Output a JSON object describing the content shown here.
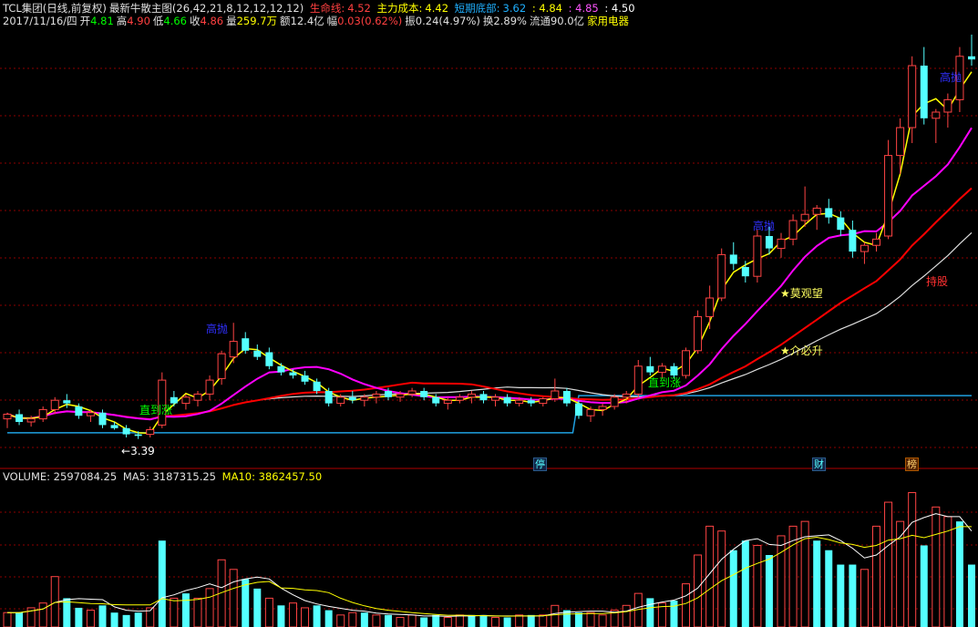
{
  "header": {
    "title": "TCL集团(日线,前复权)",
    "indicator": "最新牛散主图(26,42,21,8,12,12,12,12)",
    "life_label": "生命线:",
    "life_value": "4.52",
    "cost_label": "主力成本:",
    "cost_value": "4.42",
    "bottom_label": "短期底部:",
    "bottom_value": "3.62",
    "v1": ": 4.84",
    "v2": ": 4.85",
    "v3": ": 4.50",
    "date": "2017/11/16/四",
    "open_label": "开",
    "open": "4.81",
    "high_label": "高",
    "high": "4.90",
    "low_label": "低",
    "low": "4.66",
    "close_label": "收",
    "close": "4.86",
    "vol_label": "量",
    "vol": "259.7万",
    "amt_label": "额",
    "amt": "12.4亿",
    "chg_label": "幅",
    "chg": "0.03(0.62%)",
    "amp_label": "振",
    "amp": "0.24(4.97%)",
    "turn_label": "换",
    "turn": "2.89%",
    "float_label": "流通",
    "float": "90.0亿",
    "sector": "家用电器"
  },
  "volume_header": {
    "volume": "VOLUME: 2597084.25",
    "ma5": "MA5: 3187315.25",
    "ma10": "MA10: 3862457.50"
  },
  "annotations": {
    "low_price": "3.39",
    "gaopao1": "高抛",
    "gaopao2": "高抛",
    "gaopao3": "高抛",
    "zhidaozhang1": "直到涨",
    "zhidaozhang2": "直到涨",
    "moguanwang": "★莫观望",
    "jiebisheng": "★介必升",
    "chigu": "持股",
    "tag_ting": "停",
    "tag_cai": "财",
    "tag_bang": "榜"
  },
  "colors": {
    "up": "#ff4444",
    "down": "#54ffff",
    "ma_yellow": "#ffff00",
    "ma_magenta": "#ff00ff",
    "ma_red": "#ff0000",
    "ma_white": "#dddddd",
    "support": "#1fa0e0",
    "grid": "#8b0000"
  },
  "chart_data": {
    "type": "candlestick",
    "y_range_price": [
      3.3,
      6.0
    ],
    "candles": [
      [
        3.52,
        3.56,
        3.46,
        3.55
      ],
      [
        3.55,
        3.58,
        3.48,
        3.5
      ],
      [
        3.5,
        3.54,
        3.47,
        3.52
      ],
      [
        3.52,
        3.6,
        3.5,
        3.58
      ],
      [
        3.58,
        3.66,
        3.55,
        3.64
      ],
      [
        3.64,
        3.68,
        3.59,
        3.62
      ],
      [
        3.6,
        3.62,
        3.52,
        3.54
      ],
      [
        3.54,
        3.58,
        3.5,
        3.56
      ],
      [
        3.56,
        3.58,
        3.46,
        3.48
      ],
      [
        3.48,
        3.5,
        3.45,
        3.46
      ],
      [
        3.46,
        3.48,
        3.4,
        3.42
      ],
      [
        3.42,
        3.44,
        3.39,
        3.41
      ],
      [
        3.42,
        3.47,
        3.4,
        3.45
      ],
      [
        3.48,
        3.82,
        3.46,
        3.77
      ],
      [
        3.66,
        3.7,
        3.6,
        3.62
      ],
      [
        3.62,
        3.68,
        3.58,
        3.66
      ],
      [
        3.64,
        3.7,
        3.6,
        3.68
      ],
      [
        3.68,
        3.8,
        3.64,
        3.77
      ],
      [
        3.78,
        3.96,
        3.74,
        3.94
      ],
      [
        3.92,
        4.14,
        3.88,
        4.02
      ],
      [
        4.04,
        4.08,
        3.94,
        3.96
      ],
      [
        3.96,
        4.0,
        3.9,
        3.92
      ],
      [
        3.95,
        3.98,
        3.84,
        3.86
      ],
      [
        3.86,
        3.88,
        3.8,
        3.82
      ],
      [
        3.82,
        3.84,
        3.78,
        3.8
      ],
      [
        3.8,
        3.83,
        3.74,
        3.76
      ],
      [
        3.76,
        3.78,
        3.68,
        3.7
      ],
      [
        3.7,
        3.72,
        3.6,
        3.62
      ],
      [
        3.62,
        3.68,
        3.6,
        3.66
      ],
      [
        3.66,
        3.7,
        3.62,
        3.64
      ],
      [
        3.64,
        3.68,
        3.6,
        3.66
      ],
      [
        3.66,
        3.7,
        3.62,
        3.68
      ],
      [
        3.7,
        3.72,
        3.64,
        3.66
      ],
      [
        3.66,
        3.7,
        3.63,
        3.68
      ],
      [
        3.68,
        3.72,
        3.66,
        3.7
      ],
      [
        3.7,
        3.72,
        3.64,
        3.66
      ],
      [
        3.66,
        3.68,
        3.6,
        3.62
      ],
      [
        3.62,
        3.66,
        3.58,
        3.64
      ],
      [
        3.64,
        3.68,
        3.62,
        3.66
      ],
      [
        3.66,
        3.7,
        3.62,
        3.68
      ],
      [
        3.68,
        3.7,
        3.62,
        3.64
      ],
      [
        3.64,
        3.68,
        3.6,
        3.66
      ],
      [
        3.66,
        3.68,
        3.6,
        3.62
      ],
      [
        3.62,
        3.66,
        3.6,
        3.64
      ],
      [
        3.64,
        3.66,
        3.6,
        3.62
      ],
      [
        3.62,
        3.66,
        3.6,
        3.65
      ],
      [
        3.65,
        3.78,
        3.63,
        3.7
      ],
      [
        3.7,
        3.72,
        3.6,
        3.62
      ],
      [
        3.62,
        3.64,
        3.52,
        3.54
      ],
      [
        3.54,
        3.6,
        3.5,
        3.58
      ],
      [
        3.58,
        3.62,
        3.54,
        3.6
      ],
      [
        3.6,
        3.68,
        3.58,
        3.66
      ],
      [
        3.66,
        3.7,
        3.62,
        3.68
      ],
      [
        3.68,
        3.9,
        3.66,
        3.86
      ],
      [
        3.86,
        3.92,
        3.8,
        3.82
      ],
      [
        3.82,
        3.88,
        3.78,
        3.86
      ],
      [
        3.86,
        3.88,
        3.78,
        3.8
      ],
      [
        3.8,
        3.98,
        3.78,
        3.96
      ],
      [
        3.96,
        4.22,
        3.94,
        4.18
      ],
      [
        4.18,
        4.38,
        4.1,
        4.3
      ],
      [
        4.3,
        4.62,
        4.28,
        4.58
      ],
      [
        4.58,
        4.66,
        4.48,
        4.52
      ],
      [
        4.5,
        4.54,
        4.4,
        4.44
      ],
      [
        4.44,
        4.74,
        4.4,
        4.7
      ],
      [
        4.7,
        4.76,
        4.58,
        4.62
      ],
      [
        4.62,
        4.72,
        4.56,
        4.68
      ],
      [
        4.68,
        4.84,
        4.64,
        4.8
      ],
      [
        4.8,
        5.02,
        4.76,
        4.84
      ],
      [
        4.84,
        4.9,
        4.74,
        4.88
      ],
      [
        4.88,
        4.94,
        4.78,
        4.82
      ],
      [
        4.82,
        4.86,
        4.7,
        4.74
      ],
      [
        4.74,
        4.8,
        4.56,
        4.6
      ],
      [
        4.6,
        4.66,
        4.52,
        4.64
      ],
      [
        4.64,
        4.72,
        4.6,
        4.68
      ],
      [
        4.7,
        5.32,
        4.68,
        5.22
      ],
      [
        5.22,
        5.46,
        5.1,
        5.4
      ],
      [
        5.4,
        5.86,
        5.3,
        5.8
      ],
      [
        5.8,
        5.92,
        5.42,
        5.46
      ],
      [
        5.46,
        5.52,
        5.3,
        5.5
      ],
      [
        5.5,
        5.62,
        5.4,
        5.58
      ],
      [
        5.58,
        5.92,
        5.5,
        5.86
      ],
      [
        5.86,
        6.0,
        5.8,
        5.84
      ]
    ],
    "volume": [
      [
        0.6,
        1
      ],
      [
        0.6,
        0
      ],
      [
        0.8,
        1
      ],
      [
        1.0,
        1
      ],
      [
        2.1,
        1
      ],
      [
        1.2,
        0
      ],
      [
        0.8,
        0
      ],
      [
        0.7,
        1
      ],
      [
        0.9,
        0
      ],
      [
        0.6,
        0
      ],
      [
        0.5,
        0
      ],
      [
        0.6,
        0
      ],
      [
        0.8,
        1
      ],
      [
        3.6,
        0
      ],
      [
        1.2,
        1
      ],
      [
        1.4,
        0
      ],
      [
        1.2,
        1
      ],
      [
        1.6,
        1
      ],
      [
        2.8,
        1
      ],
      [
        2.4,
        1
      ],
      [
        2.0,
        0
      ],
      [
        1.6,
        0
      ],
      [
        1.2,
        1
      ],
      [
        0.9,
        0
      ],
      [
        1.0,
        1
      ],
      [
        0.8,
        1
      ],
      [
        0.9,
        0
      ],
      [
        0.7,
        0
      ],
      [
        0.5,
        1
      ],
      [
        0.6,
        1
      ],
      [
        0.6,
        0
      ],
      [
        0.5,
        1
      ],
      [
        0.5,
        0
      ],
      [
        0.4,
        1
      ],
      [
        0.5,
        1
      ],
      [
        0.4,
        0
      ],
      [
        0.5,
        0
      ],
      [
        0.4,
        1
      ],
      [
        0.5,
        1
      ],
      [
        0.5,
        0
      ],
      [
        0.5,
        0
      ],
      [
        0.4,
        1
      ],
      [
        0.4,
        0
      ],
      [
        0.5,
        1
      ],
      [
        0.5,
        0
      ],
      [
        0.5,
        1
      ],
      [
        0.9,
        1
      ],
      [
        0.7,
        0
      ],
      [
        0.6,
        0
      ],
      [
        0.6,
        1
      ],
      [
        0.5,
        1
      ],
      [
        0.7,
        1
      ],
      [
        0.9,
        1
      ],
      [
        1.4,
        1
      ],
      [
        1.2,
        0
      ],
      [
        1.0,
        1
      ],
      [
        1.1,
        0
      ],
      [
        1.8,
        1
      ],
      [
        3.0,
        1
      ],
      [
        4.2,
        1
      ],
      [
        4.0,
        1
      ],
      [
        3.2,
        0
      ],
      [
        3.6,
        0
      ],
      [
        3.4,
        1
      ],
      [
        3.0,
        0
      ],
      [
        3.8,
        1
      ],
      [
        4.2,
        1
      ],
      [
        4.4,
        1
      ],
      [
        3.6,
        0
      ],
      [
        3.2,
        0
      ],
      [
        2.6,
        0
      ],
      [
        2.6,
        0
      ],
      [
        2.4,
        1
      ],
      [
        4.2,
        1
      ],
      [
        5.2,
        1
      ],
      [
        4.4,
        1
      ],
      [
        5.6,
        1
      ],
      [
        3.4,
        0
      ],
      [
        5.0,
        1
      ],
      [
        4.6,
        1
      ],
      [
        4.4,
        0
      ],
      [
        2.6,
        0
      ]
    ]
  }
}
